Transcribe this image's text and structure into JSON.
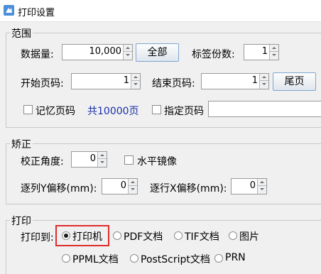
{
  "window": {
    "title": "打印设置"
  },
  "range_group": {
    "title": "范围",
    "quantity_label": "数据量:",
    "quantity_value": "10,000",
    "all_button": "全部",
    "label_copies_label": "标签份数:",
    "label_copies_value": "1",
    "start_page_label": "开始页码:",
    "start_page_value": "1",
    "end_page_label": "结束页码:",
    "end_page_value": "1",
    "last_page_button": "尾页",
    "remember_page_label": "记忆页码",
    "total_pages_text": "共10000页",
    "specify_page_label": "指定页码",
    "specify_page_value": ""
  },
  "correction_group": {
    "title": "矫正",
    "angle_label": "校正角度:",
    "angle_value": "0",
    "horizontal_mirror_label": "水平镜像",
    "column_y_offset_label": "逐列Y偏移(mm):",
    "column_y_offset_value": "0",
    "row_x_offset_label": "逐行X偏移(mm):",
    "row_x_offset_value": "0"
  },
  "print_group": {
    "title": "打印",
    "print_to_label": "打印到:",
    "options": [
      "打印机",
      "PDF文档",
      "TIF文档",
      "图片",
      "PPML文档",
      "PostScript文档",
      "PRN"
    ],
    "selected": "打印机"
  },
  "colors": {
    "accent_highlight": "#e02b2b",
    "total_text": "#1b2fa8"
  }
}
